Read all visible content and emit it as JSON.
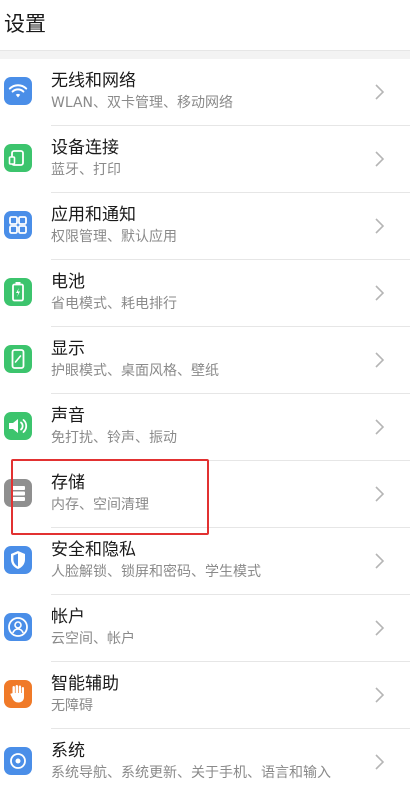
{
  "header": {
    "title": "设置"
  },
  "colors": {
    "wifi": "#4a8ee8",
    "device": "#3cc46d",
    "apps": "#4a8ee8",
    "battery": "#3cc46d",
    "display": "#3cc46d",
    "sound": "#3cc46d",
    "storage": "#8f8f8f",
    "security": "#4a8ee8",
    "account": "#4a8ee8",
    "accessibility": "#f07a28",
    "system": "#4a8ee8",
    "highlight": "#e23131"
  },
  "items": [
    {
      "title": "无线和网络",
      "subtitle": "WLAN、双卡管理、移动网络",
      "icon": "wifi-icon"
    },
    {
      "title": "设备连接",
      "subtitle": "蓝牙、打印",
      "icon": "device-connect-icon"
    },
    {
      "title": "应用和通知",
      "subtitle": "权限管理、默认应用",
      "icon": "apps-icon"
    },
    {
      "title": "电池",
      "subtitle": "省电模式、耗电排行",
      "icon": "battery-icon"
    },
    {
      "title": "显示",
      "subtitle": "护眼模式、桌面风格、壁纸",
      "icon": "display-icon"
    },
    {
      "title": "声音",
      "subtitle": "免打扰、铃声、振动",
      "icon": "sound-icon"
    },
    {
      "title": "存储",
      "subtitle": "内存、空间清理",
      "icon": "storage-icon"
    },
    {
      "title": "安全和隐私",
      "subtitle": "人脸解锁、锁屏和密码、学生模式",
      "icon": "security-icon"
    },
    {
      "title": "帐户",
      "subtitle": "云空间、帐户",
      "icon": "account-icon"
    },
    {
      "title": "智能辅助",
      "subtitle": "无障碍",
      "icon": "accessibility-icon"
    },
    {
      "title": "系统",
      "subtitle": "系统导航、系统更新、关于手机、语言和输入",
      "icon": "system-icon"
    }
  ]
}
